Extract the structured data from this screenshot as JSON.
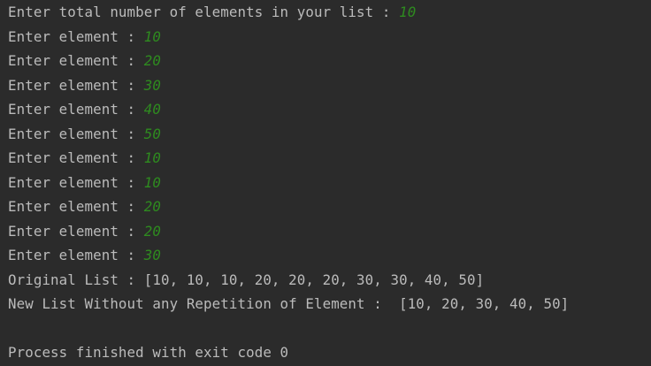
{
  "console": {
    "lines": [
      {
        "prompt": "Enter total number of elements in your list : ",
        "input": "10"
      },
      {
        "prompt": "Enter element : ",
        "input": "10"
      },
      {
        "prompt": "Enter element : ",
        "input": "20"
      },
      {
        "prompt": "Enter element : ",
        "input": "30"
      },
      {
        "prompt": "Enter element : ",
        "input": "40"
      },
      {
        "prompt": "Enter element : ",
        "input": "50"
      },
      {
        "prompt": "Enter element : ",
        "input": "10"
      },
      {
        "prompt": "Enter element : ",
        "input": "10"
      },
      {
        "prompt": "Enter element : ",
        "input": "20"
      },
      {
        "prompt": "Enter element : ",
        "input": "20"
      },
      {
        "prompt": "Enter element : ",
        "input": "30"
      }
    ],
    "original_list": "Original List : [10, 10, 10, 20, 20, 20, 30, 30, 40, 50]",
    "new_list": "New List Without any Repetition of Element :  [10, 20, 30, 40, 50]",
    "exit_message": "Process finished with exit code 0"
  },
  "colors": {
    "background": "#2b2b2b",
    "output_text": "#bbbbbb",
    "user_input": "#2e8b1f"
  }
}
